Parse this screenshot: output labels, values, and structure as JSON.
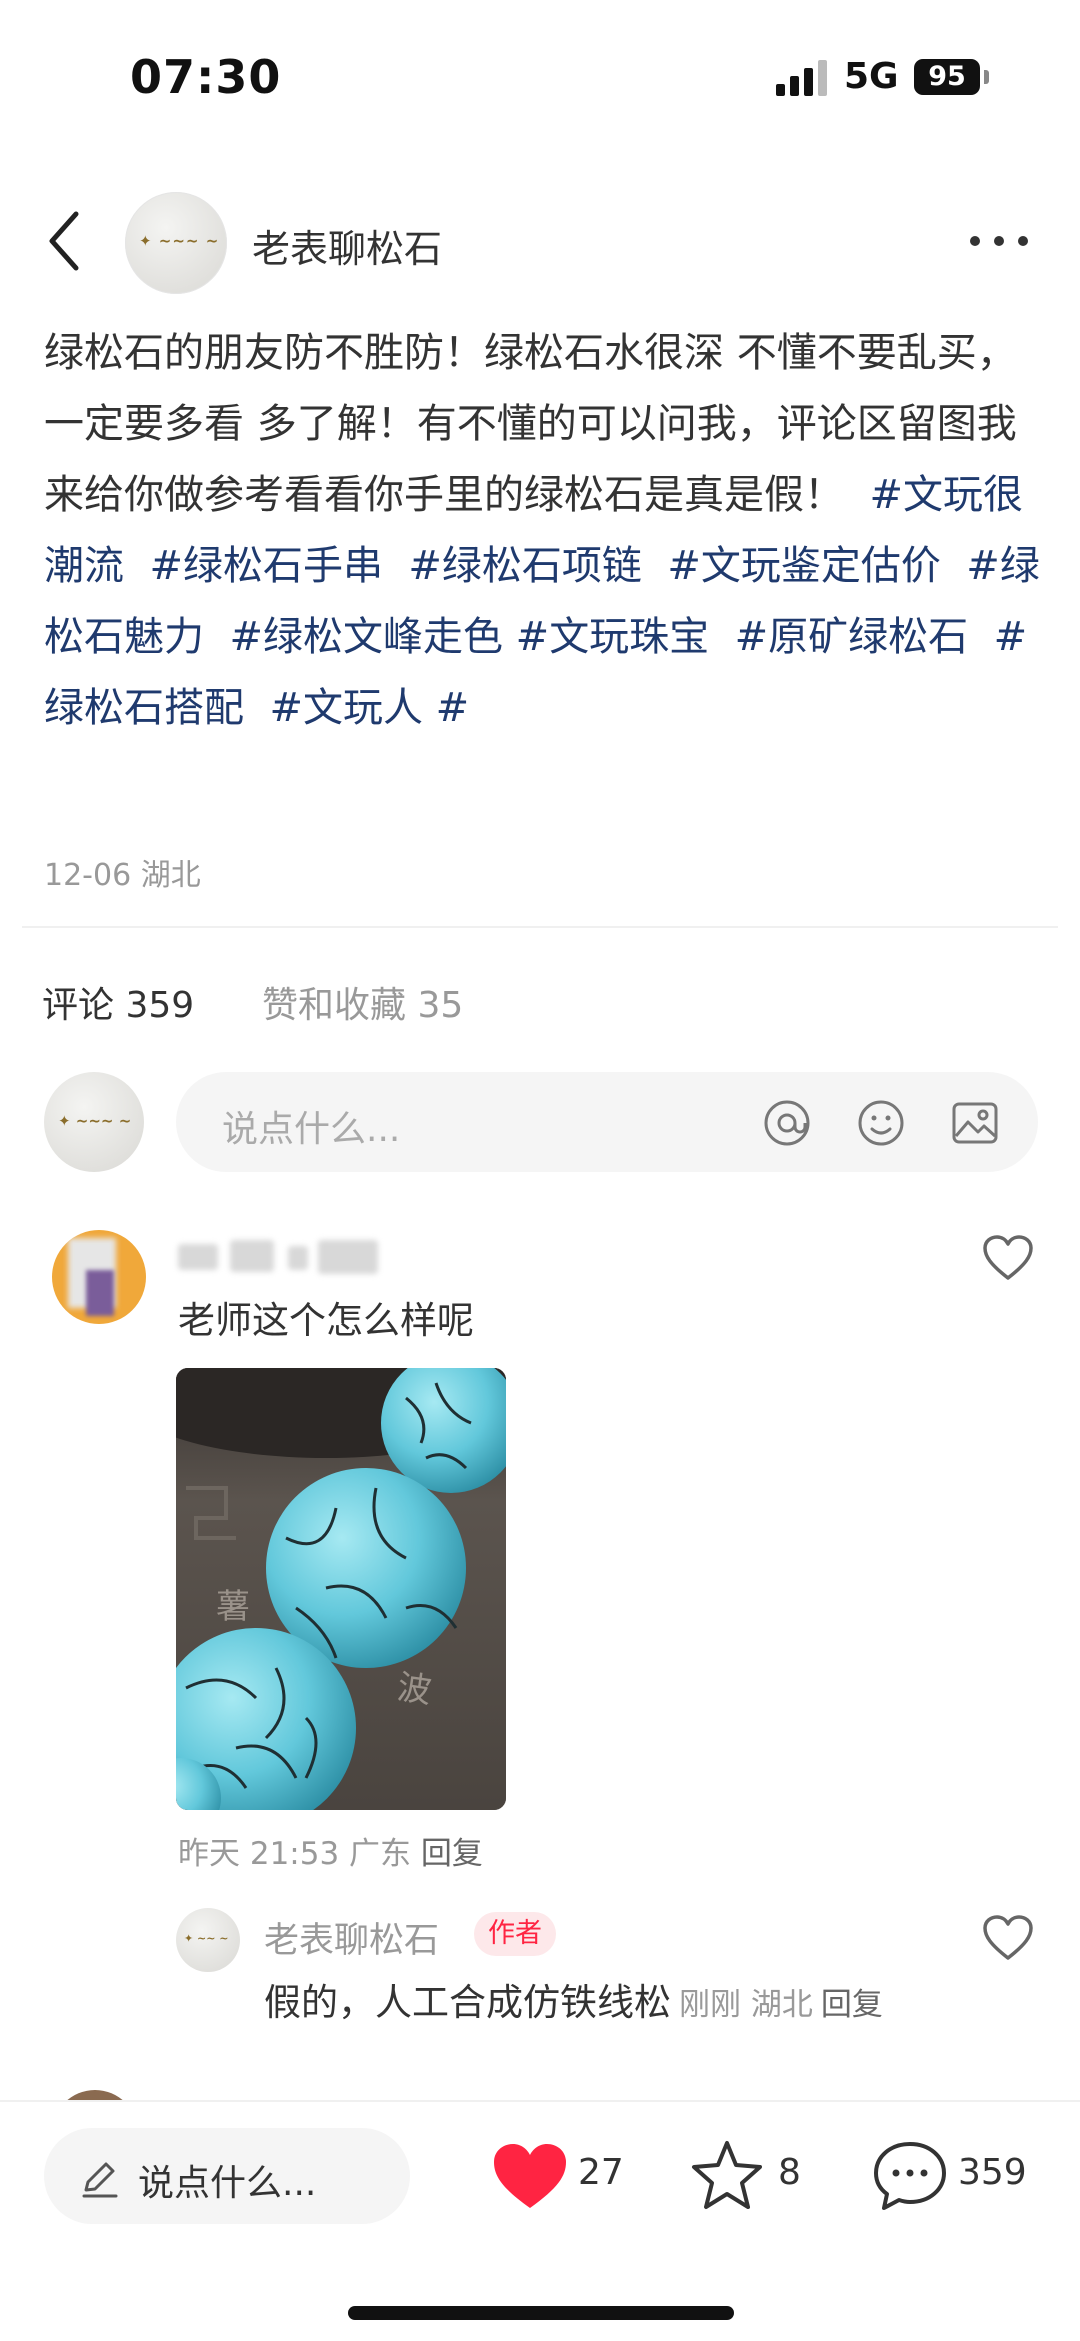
{
  "status_bar": {
    "time": "07:30",
    "network": "5G",
    "battery": "95"
  },
  "header": {
    "author_name": "老表聊松石"
  },
  "post": {
    "text": "绿松石的朋友防不胜防！绿松石水很深 不懂不要乱买，一定要多看 多了解！有不懂的可以问我，评论区留图我来给你做参考看看你手里的绿松石是真是假！",
    "tags": [
      "#文玩很潮流",
      "#绿松石手串",
      "#绿松石项链",
      "#文玩鉴定估价",
      "#绿松石魅力",
      "#绿松文峰走色",
      "#文玩珠宝",
      "#原矿绿松石",
      "#绿松石搭配",
      "#文玩人",
      "#"
    ],
    "meta": "12-06 湖北"
  },
  "tabs": {
    "comments_label": "评论 359",
    "likes_label": "赞和收藏",
    "likes_count": "35"
  },
  "comment_input": {
    "placeholder": "说点什么..."
  },
  "comments": [
    {
      "text": "老师这个怎么样呢",
      "meta": "昨天 21:53 广东",
      "reply_label": "回复",
      "reply": {
        "author": "老表聊松石",
        "badge": "作者",
        "text": "假的，人工合成仿铁线松",
        "meta": "刚刚 湖北",
        "reply_label": "回复"
      }
    }
  ],
  "bottom_bar": {
    "input_placeholder": "说点什么...",
    "likes": "27",
    "stars": "8",
    "comments": "359"
  },
  "colors": {
    "tag": "#1f3a6e",
    "heart": "#ff2442",
    "author_badge_bg": "#fde8ea"
  },
  "icons": {
    "back": "chevron-left-icon",
    "more": "more-horizontal-icon",
    "mention": "at-icon",
    "emoji": "smile-icon",
    "image": "image-icon",
    "like": "heart-icon",
    "collect": "star-icon",
    "comment": "chat-bubble-icon",
    "edit": "pencil-icon"
  }
}
